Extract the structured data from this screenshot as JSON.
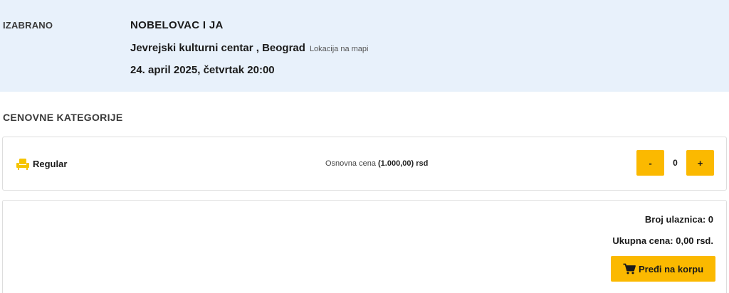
{
  "selected": {
    "label": "IZABRANO",
    "event_title": "NOBELOVAC I JA",
    "venue": "Jevrejski kulturni centar , Beograd",
    "map_link": "Lokacija na mapi",
    "date": "24. april 2025, četvrtak 20:00"
  },
  "categories": {
    "heading": "CENOVNE KATEGORIJE",
    "items": [
      {
        "icon": "seat-icon",
        "name": "Regular",
        "price_prefix": "Osnovna cena",
        "price_value": "(1.000,00)",
        "price_currency": "rsd",
        "minus_label": "-",
        "plus_label": "+",
        "quantity": "0"
      }
    ]
  },
  "summary": {
    "ticket_count": "Broj ulaznica: 0",
    "total_price": "Ukupna cena: 0,00 rsd.",
    "cart_button_label": "Pređi na korpu",
    "cart_icon": "cart-icon"
  },
  "colors": {
    "accent": "#fbb900",
    "panel_background": "#e8f1fb",
    "seat_icon": "#f5c400"
  }
}
